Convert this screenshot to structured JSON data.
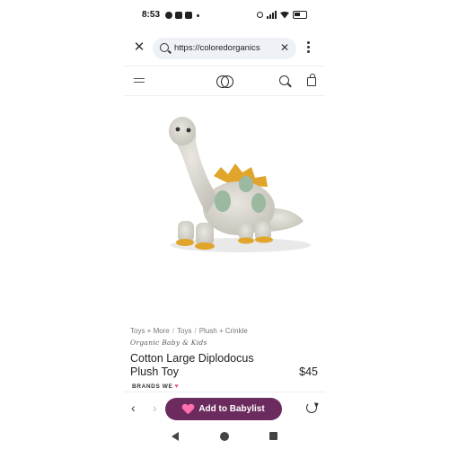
{
  "status_bar": {
    "time": "8:53"
  },
  "browser": {
    "url": "https://coloredorganics",
    "close_icon": "close-icon",
    "menu_icon": "kebab-menu-icon"
  },
  "product": {
    "breadcrumb": [
      "Toys + More",
      "Toys",
      "Plush + Crinkle"
    ],
    "brand": "Organic Baby & Kids",
    "title": "Cotton Large Diplodocus Plush Toy",
    "price": "$45",
    "brands_we": "BRANDS WE"
  },
  "toolbar": {
    "babylist_label": "Add to Babylist"
  },
  "colors": {
    "babylist_button": "#6b2b5e",
    "babylist_heart": "#ff6fae",
    "dino_body": "#d9d6ce",
    "dino_spots": "#9bb8a0",
    "dino_spikes": "#e0a52a"
  }
}
